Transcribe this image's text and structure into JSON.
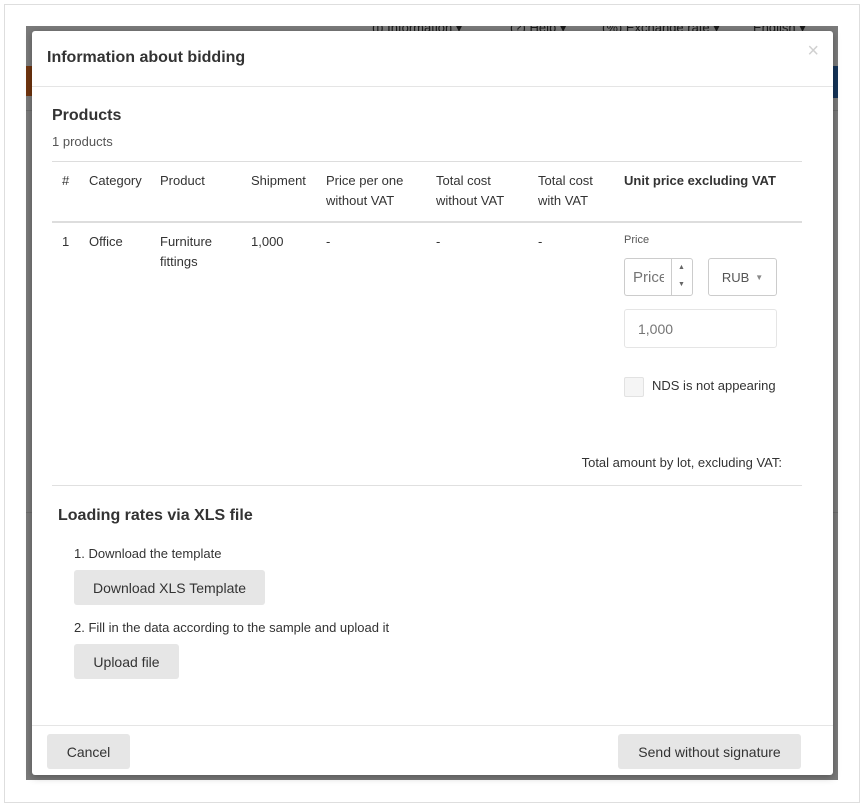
{
  "background": {
    "nav": {
      "information": "(i) Information ▾",
      "help": "(?) Help ▾",
      "exchange_rate": "(%) Exchange rate ▾",
      "language": "English ▾"
    }
  },
  "modal": {
    "title": "Information about bidding",
    "close_icon": "×",
    "products_heading": "Products",
    "products_count": "1 products",
    "table": {
      "headers": {
        "num": "#",
        "category": "Category",
        "product": "Product",
        "shipment": "Shipment",
        "price_per_one": "Price per one without VAT",
        "total_cost_wo": "Total cost without VAT",
        "total_cost_with": "Total cost with VAT",
        "unit_price": "Unit price excluding VAT"
      },
      "row": {
        "num": "1",
        "category": "Office",
        "product": "Furniture fittings",
        "shipment": "1,000",
        "price_per_one": "-",
        "total_cost_wo": "-",
        "total_cost_with": "-"
      }
    },
    "price_label": "Price",
    "price_placeholder": "Price",
    "currency": "RUB",
    "quantity_placeholder": "1,000",
    "nds_label": "NDS is not appearing",
    "total_label": "Total amount by lot, excluding VAT:",
    "xls": {
      "heading": "Loading rates via XLS file",
      "step1": "1. Download the template",
      "download_button": "Download XLS Template",
      "step2": "2. Fill in the data according to the sample and upload it",
      "upload_button": "Upload file"
    },
    "footer": {
      "cancel": "Cancel",
      "send": "Send without signature"
    }
  }
}
